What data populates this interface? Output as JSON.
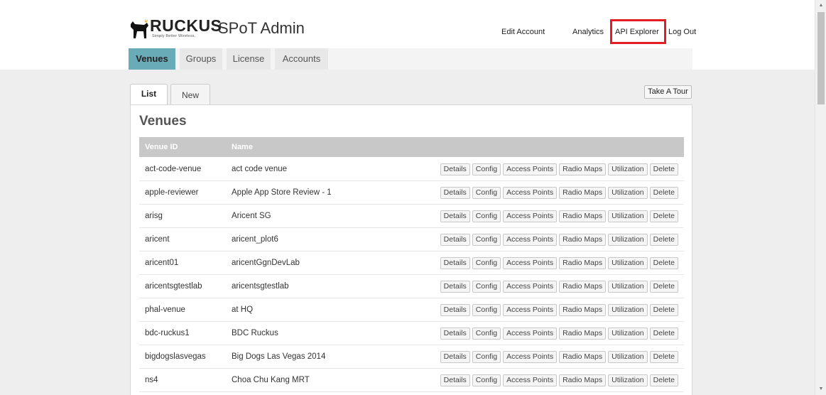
{
  "header": {
    "brand": "RUCKUS",
    "brand_tagline": "Simply Better Wireless.",
    "app_title": "SPoT Admin",
    "links": {
      "edit_account": "Edit Account",
      "analytics": "Analytics",
      "api_explorer": "API Explorer",
      "log_out": "Log Out"
    },
    "highlight_color": "#e41c24"
  },
  "nav_tabs": [
    {
      "label": "Venues",
      "active": true
    },
    {
      "label": "Groups",
      "active": false
    },
    {
      "label": "License",
      "active": false
    },
    {
      "label": "Accounts",
      "active": false
    }
  ],
  "panel_tabs": [
    {
      "label": "List",
      "active": true
    },
    {
      "label": "New",
      "active": false
    }
  ],
  "tour_button": "Take A Tour",
  "panel_title": "Venues",
  "table": {
    "columns": [
      "Venue ID",
      "Name"
    ],
    "action_labels": [
      "Details",
      "Config",
      "Access Points",
      "Radio Maps",
      "Utilization",
      "Delete"
    ],
    "rows": [
      {
        "id": "act-code-venue",
        "name": "act code venue"
      },
      {
        "id": "apple-reviewer",
        "name": "Apple App Store Review - 1"
      },
      {
        "id": "arisg",
        "name": "Aricent SG"
      },
      {
        "id": "aricent",
        "name": "aricent_plot6"
      },
      {
        "id": "aricent01",
        "name": "aricentGgnDevLab"
      },
      {
        "id": "aricentsgtestlab",
        "name": "aricentsgtestlab"
      },
      {
        "id": "phal-venue",
        "name": "at HQ"
      },
      {
        "id": "bdc-ruckus1",
        "name": "BDC Ruckus"
      },
      {
        "id": "bigdogslasvegas",
        "name": "Big Dogs Las Vegas 2014"
      },
      {
        "id": "ns4",
        "name": "Choa Chu Kang MRT"
      }
    ]
  },
  "colors": {
    "active_tab": "#6aabb8",
    "table_header": "#c8c8c8",
    "page_background": "#eeeeee"
  },
  "icons": {
    "logo": "dog-logo-icon",
    "scroll_up": "scroll-up-arrow-icon",
    "scroll_down": "scroll-down-arrow-icon"
  }
}
